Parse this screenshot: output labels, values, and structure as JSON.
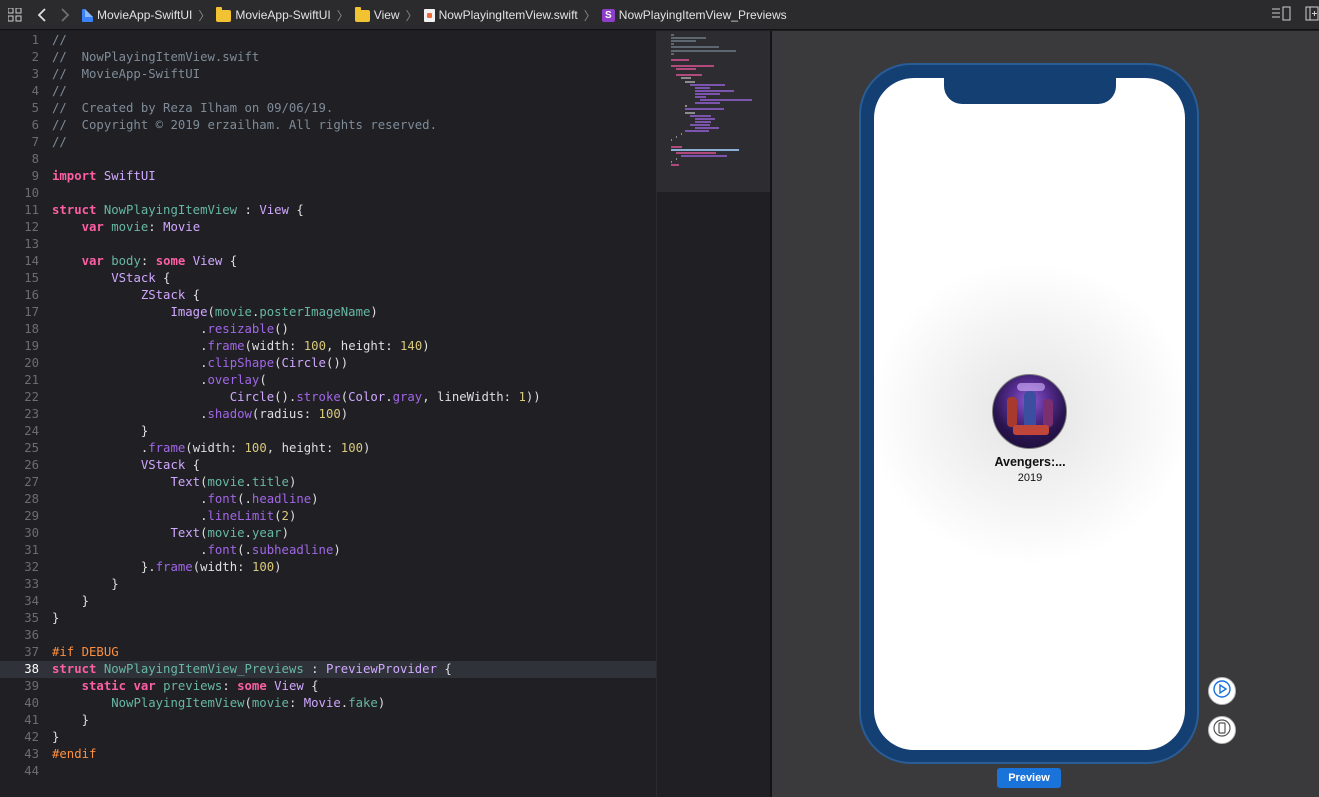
{
  "toolbar": {
    "breadcrumbs": [
      "MovieApp-SwiftUI",
      "MovieApp-SwiftUI",
      "View",
      "NowPlayingItemView.swift",
      "NowPlayingItemView_Previews"
    ],
    "separator": "〉"
  },
  "editor": {
    "current_line": 38,
    "lines": [
      {
        "n": "1",
        "t": "//"
      },
      {
        "n": "2",
        "t": "//  NowPlayingItemView.swift"
      },
      {
        "n": "3",
        "t": "//  MovieApp-SwiftUI"
      },
      {
        "n": "4",
        "t": "//"
      },
      {
        "n": "5",
        "t": "//  Created by Reza Ilham on 09/06/19."
      },
      {
        "n": "6",
        "t": "//  Copyright © 2019 erzailham. All rights reserved."
      },
      {
        "n": "7",
        "t": "//"
      },
      {
        "n": "8",
        "t": ""
      },
      {
        "n": "9",
        "t": "import SwiftUI"
      },
      {
        "n": "10",
        "t": ""
      },
      {
        "n": "11",
        "t": "struct NowPlayingItemView : View {"
      },
      {
        "n": "12",
        "t": "    var movie: Movie"
      },
      {
        "n": "13",
        "t": ""
      },
      {
        "n": "14",
        "t": "    var body: some View {"
      },
      {
        "n": "15",
        "t": "        VStack {"
      },
      {
        "n": "16",
        "t": "            ZStack {"
      },
      {
        "n": "17",
        "t": "                Image(movie.posterImageName)"
      },
      {
        "n": "18",
        "t": "                    .resizable()"
      },
      {
        "n": "19",
        "t": "                    .frame(width: 100, height: 140)"
      },
      {
        "n": "20",
        "t": "                    .clipShape(Circle())"
      },
      {
        "n": "21",
        "t": "                    .overlay("
      },
      {
        "n": "22",
        "t": "                        Circle().stroke(Color.gray, lineWidth: 1))"
      },
      {
        "n": "23",
        "t": "                    .shadow(radius: 100)"
      },
      {
        "n": "24",
        "t": "            }"
      },
      {
        "n": "25",
        "t": "            .frame(width: 100, height: 100)"
      },
      {
        "n": "26",
        "t": "            VStack {"
      },
      {
        "n": "27",
        "t": "                Text(movie.title)"
      },
      {
        "n": "28",
        "t": "                    .font(.headline)"
      },
      {
        "n": "29",
        "t": "                    .lineLimit(2)"
      },
      {
        "n": "30",
        "t": "                Text(movie.year)"
      },
      {
        "n": "31",
        "t": "                    .font(.subheadline)"
      },
      {
        "n": "32",
        "t": "            }.frame(width: 100)"
      },
      {
        "n": "33",
        "t": "        }"
      },
      {
        "n": "34",
        "t": "    }"
      },
      {
        "n": "35",
        "t": "}"
      },
      {
        "n": "36",
        "t": ""
      },
      {
        "n": "37",
        "t": "#if DEBUG"
      },
      {
        "n": "38",
        "t": "struct NowPlayingItemView_Previews : PreviewProvider {"
      },
      {
        "n": "39",
        "t": "    static var previews: some View {"
      },
      {
        "n": "40",
        "t": "        NowPlayingItemView(movie: Movie.fake)"
      },
      {
        "n": "41",
        "t": "    }"
      },
      {
        "n": "42",
        "t": "}"
      },
      {
        "n": "43",
        "t": "#endif"
      },
      {
        "n": "44",
        "t": ""
      }
    ]
  },
  "preview": {
    "movie_title": "Avengers:...",
    "movie_year": "2019",
    "button_label": "Preview"
  },
  "colors": {
    "comment": "#7f8c98",
    "keyword": "#fc5fa3",
    "type": "#d0a8ff",
    "project_symbol": "#67b7a4",
    "method": "#a167e6",
    "number": "#d9c97c",
    "preprocessor": "#fd8f3f",
    "device_frame": "#133f73",
    "preview_button": "#1a73d9"
  },
  "icons": [
    "grid-icon",
    "back-arrow-icon",
    "forward-arrow-icon",
    "swift-file-icon",
    "folder-icon",
    "struct-symbol-icon",
    "editor-options-icon",
    "add-editor-icon",
    "live-preview-icon",
    "device-icon"
  ]
}
